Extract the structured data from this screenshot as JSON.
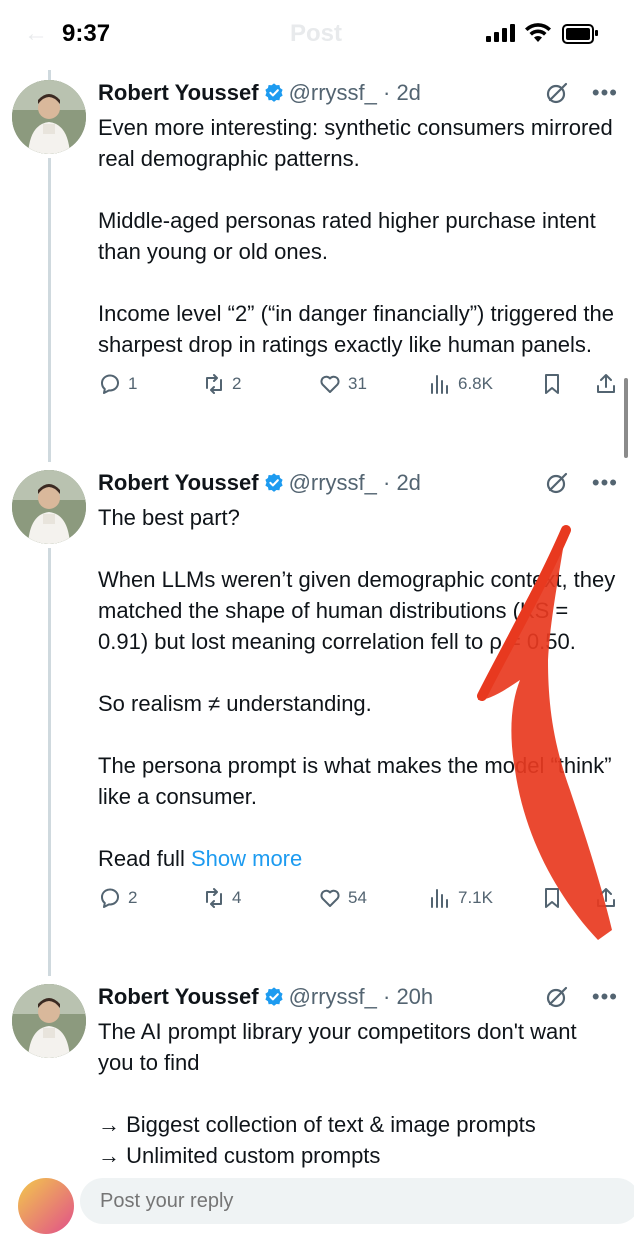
{
  "status_bar": {
    "time": "9:37"
  },
  "header": {
    "title": "Post"
  },
  "tweets": [
    {
      "name": "Robert Youssef",
      "handle": "@rryssf_ · 2d",
      "paragraphs": [
        "Even more interesting: synthetic consumers mirrored real demographic patterns.",
        "Middle-aged personas rated higher purchase intent than young or old ones.",
        "Income level “2” (“in danger financially”) triggered the sharpest drop in ratings exactly like human panels."
      ],
      "replies": "1",
      "reposts": "2",
      "likes": "31",
      "views": "6.8K"
    },
    {
      "name": "Robert Youssef",
      "handle": "@rryssf_ · 2d",
      "paragraphs": [
        "The best part?",
        "When LLMs weren’t given demographic context, they matched the shape of human distributions (KS = 0.91) but lost meaning correlation fell to ρ = 0.50.",
        "So realism ≠ understanding.",
        "The persona prompt is what makes the model “think” like a consumer."
      ],
      "read_full": "Read full",
      "show_more": "Show more",
      "replies": "2",
      "reposts": "4",
      "likes": "54",
      "views": "7.1K"
    },
    {
      "name": "Robert Youssef",
      "handle": "@rryssf_ · 20h",
      "paragraphs": [
        "The AI prompt library your competitors don't want you to find",
        "→ Biggest collection of text & image prompts\n→ Unlimited custom prompts"
      ]
    }
  ],
  "compose": {
    "placeholder": "Post your reply"
  },
  "icons": {
    "verified": "verified-badge-icon",
    "grok": "grok-icon",
    "more": "more-icon",
    "reply": "reply-icon",
    "repost": "repost-icon",
    "like": "like-icon",
    "views": "views-icon",
    "bookmark": "bookmark-icon",
    "share": "share-icon"
  },
  "colors": {
    "accent": "#1d9bf0",
    "annotation": "#e8391f",
    "muted": "#536471"
  }
}
